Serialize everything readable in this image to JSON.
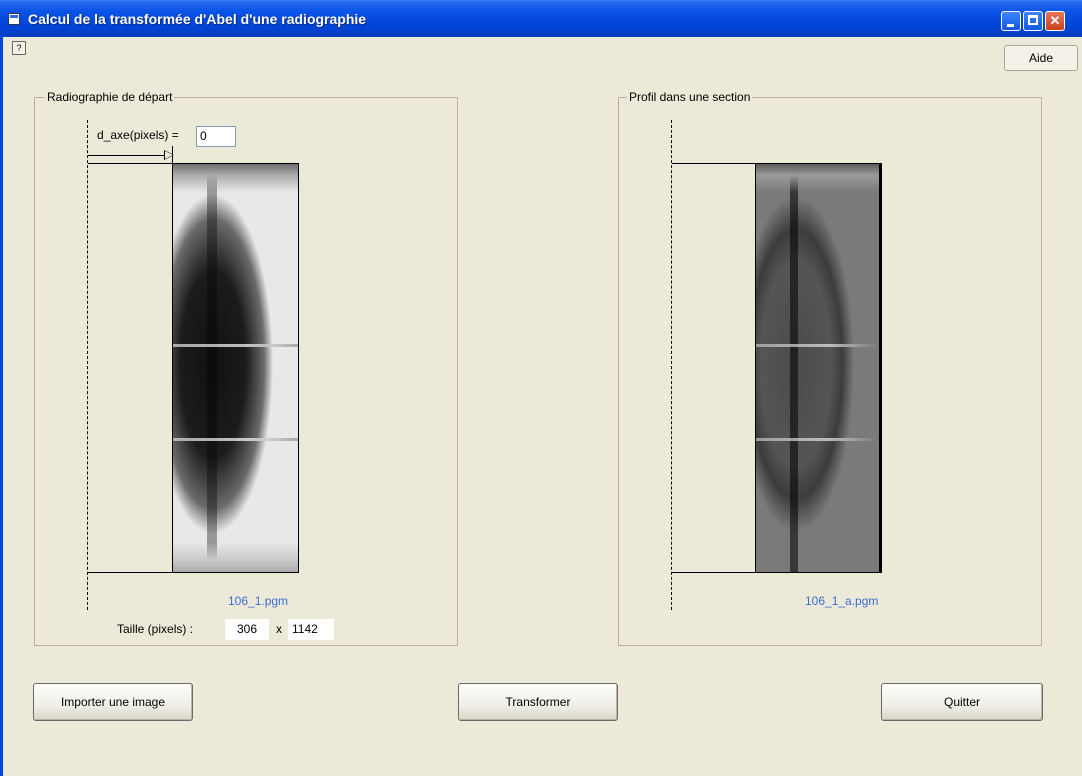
{
  "window": {
    "title": "Calcul de la transformée d'Abel d'une radiographie",
    "help_corner_glyph": "?"
  },
  "menu": {
    "aide_label": "Aide"
  },
  "left_group": {
    "legend": "Radiographie de départ",
    "axis_label": "d_axe(pixels) =",
    "axis_value": "0",
    "filename": "106_1.pgm",
    "size_label": "Taille (pixels) :",
    "size_width": "306",
    "size_sep": "x",
    "size_height": "1142"
  },
  "right_group": {
    "legend": "Profil dans une section",
    "filename": "106_1_a.pgm"
  },
  "buttons": {
    "import_label": "Importer une image",
    "transform_label": "Transformer",
    "quit_label": "Quitter"
  },
  "colors": {
    "titlebar": "#0a52e6",
    "background": "#ece9d8",
    "filename_text": "#3a6fd0"
  }
}
